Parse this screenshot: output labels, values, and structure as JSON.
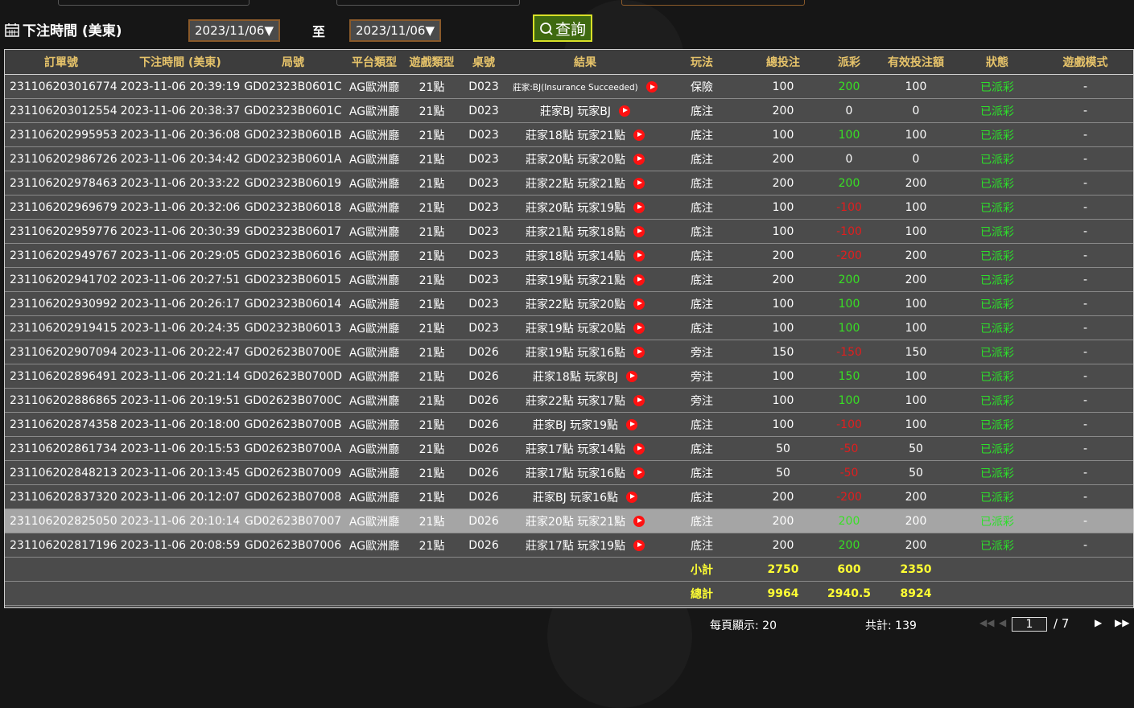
{
  "filter": {
    "label": "下注時間 (美東)",
    "start_date": "2023/11/06▼",
    "to": "至",
    "end_date": "2023/11/06▼",
    "search_label": "查詢"
  },
  "table": {
    "headers": [
      "訂單號",
      "下注時間 (美東)",
      "局號",
      "平台類型",
      "遊戲類型",
      "桌號",
      "結果",
      "玩法",
      "總投注",
      "派彩",
      "有效投注額",
      "狀態",
      "遊戲模式"
    ],
    "rows": [
      {
        "order": "231106203016774",
        "time": "2023-11-06 20:39:19",
        "round": "GD02323B0601C",
        "platform": "AG歐洲廳",
        "game": "21點",
        "table": "D023",
        "result": "莊家:BJ(Insurance Succeeded)",
        "play": "保險",
        "bet": "100",
        "payout": "200",
        "valid": "100",
        "status": "已派彩",
        "mode": "-"
      },
      {
        "order": "231106203012554",
        "time": "2023-11-06 20:38:37",
        "round": "GD02323B0601C",
        "platform": "AG歐洲廳",
        "game": "21點",
        "table": "D023",
        "result": "莊家BJ 玩家BJ",
        "play": "底注",
        "bet": "200",
        "payout": "0",
        "valid": "0",
        "status": "已派彩",
        "mode": "-"
      },
      {
        "order": "231106202995953",
        "time": "2023-11-06 20:36:08",
        "round": "GD02323B0601B",
        "platform": "AG歐洲廳",
        "game": "21點",
        "table": "D023",
        "result": "莊家18點 玩家21點",
        "play": "底注",
        "bet": "100",
        "payout": "100",
        "valid": "100",
        "status": "已派彩",
        "mode": "-"
      },
      {
        "order": "231106202986726",
        "time": "2023-11-06 20:34:42",
        "round": "GD02323B0601A",
        "platform": "AG歐洲廳",
        "game": "21點",
        "table": "D023",
        "result": "莊家20點 玩家20點",
        "play": "底注",
        "bet": "200",
        "payout": "0",
        "valid": "0",
        "status": "已派彩",
        "mode": "-"
      },
      {
        "order": "231106202978463",
        "time": "2023-11-06 20:33:22",
        "round": "GD02323B06019",
        "platform": "AG歐洲廳",
        "game": "21點",
        "table": "D023",
        "result": "莊家22點 玩家21點",
        "play": "底注",
        "bet": "200",
        "payout": "200",
        "valid": "200",
        "status": "已派彩",
        "mode": "-"
      },
      {
        "order": "231106202969679",
        "time": "2023-11-06 20:32:06",
        "round": "GD02323B06018",
        "platform": "AG歐洲廳",
        "game": "21點",
        "table": "D023",
        "result": "莊家20點 玩家19點",
        "play": "底注",
        "bet": "100",
        "payout": "-100",
        "valid": "100",
        "status": "已派彩",
        "mode": "-"
      },
      {
        "order": "231106202959776",
        "time": "2023-11-06 20:30:39",
        "round": "GD02323B06017",
        "platform": "AG歐洲廳",
        "game": "21點",
        "table": "D023",
        "result": "莊家21點 玩家18點",
        "play": "底注",
        "bet": "100",
        "payout": "-100",
        "valid": "100",
        "status": "已派彩",
        "mode": "-"
      },
      {
        "order": "231106202949767",
        "time": "2023-11-06 20:29:05",
        "round": "GD02323B06016",
        "platform": "AG歐洲廳",
        "game": "21點",
        "table": "D023",
        "result": "莊家18點 玩家14點",
        "play": "底注",
        "bet": "200",
        "payout": "-200",
        "valid": "200",
        "status": "已派彩",
        "mode": "-"
      },
      {
        "order": "231106202941702",
        "time": "2023-11-06 20:27:51",
        "round": "GD02323B06015",
        "platform": "AG歐洲廳",
        "game": "21點",
        "table": "D023",
        "result": "莊家19點 玩家21點",
        "play": "底注",
        "bet": "200",
        "payout": "200",
        "valid": "200",
        "status": "已派彩",
        "mode": "-"
      },
      {
        "order": "231106202930992",
        "time": "2023-11-06 20:26:17",
        "round": "GD02323B06014",
        "platform": "AG歐洲廳",
        "game": "21點",
        "table": "D023",
        "result": "莊家22點 玩家20點",
        "play": "底注",
        "bet": "100",
        "payout": "100",
        "valid": "100",
        "status": "已派彩",
        "mode": "-"
      },
      {
        "order": "231106202919415",
        "time": "2023-11-06 20:24:35",
        "round": "GD02323B06013",
        "platform": "AG歐洲廳",
        "game": "21點",
        "table": "D023",
        "result": "莊家19點 玩家20點",
        "play": "底注",
        "bet": "100",
        "payout": "100",
        "valid": "100",
        "status": "已派彩",
        "mode": "-"
      },
      {
        "order": "231106202907094",
        "time": "2023-11-06 20:22:47",
        "round": "GD02623B0700E",
        "platform": "AG歐洲廳",
        "game": "21點",
        "table": "D026",
        "result": "莊家19點 玩家16點",
        "play": "旁注",
        "bet": "150",
        "payout": "-150",
        "valid": "150",
        "status": "已派彩",
        "mode": "-"
      },
      {
        "order": "231106202896491",
        "time": "2023-11-06 20:21:14",
        "round": "GD02623B0700D",
        "platform": "AG歐洲廳",
        "game": "21點",
        "table": "D026",
        "result": "莊家18點 玩家BJ",
        "play": "旁注",
        "bet": "100",
        "payout": "150",
        "valid": "100",
        "status": "已派彩",
        "mode": "-"
      },
      {
        "order": "231106202886865",
        "time": "2023-11-06 20:19:51",
        "round": "GD02623B0700C",
        "platform": "AG歐洲廳",
        "game": "21點",
        "table": "D026",
        "result": "莊家22點 玩家17點",
        "play": "旁注",
        "bet": "100",
        "payout": "100",
        "valid": "100",
        "status": "已派彩",
        "mode": "-"
      },
      {
        "order": "231106202874358",
        "time": "2023-11-06 20:18:00",
        "round": "GD02623B0700B",
        "platform": "AG歐洲廳",
        "game": "21點",
        "table": "D026",
        "result": "莊家BJ 玩家19點",
        "play": "底注",
        "bet": "100",
        "payout": "-100",
        "valid": "100",
        "status": "已派彩",
        "mode": "-"
      },
      {
        "order": "231106202861734",
        "time": "2023-11-06 20:15:53",
        "round": "GD02623B0700A",
        "platform": "AG歐洲廳",
        "game": "21點",
        "table": "D026",
        "result": "莊家17點 玩家14點",
        "play": "底注",
        "bet": "50",
        "payout": "-50",
        "valid": "50",
        "status": "已派彩",
        "mode": "-"
      },
      {
        "order": "231106202848213",
        "time": "2023-11-06 20:13:45",
        "round": "GD02623B07009",
        "platform": "AG歐洲廳",
        "game": "21點",
        "table": "D026",
        "result": "莊家17點 玩家16點",
        "play": "底注",
        "bet": "50",
        "payout": "-50",
        "valid": "50",
        "status": "已派彩",
        "mode": "-"
      },
      {
        "order": "231106202837320",
        "time": "2023-11-06 20:12:07",
        "round": "GD02623B07008",
        "platform": "AG歐洲廳",
        "game": "21點",
        "table": "D026",
        "result": "莊家BJ 玩家16點",
        "play": "底注",
        "bet": "200",
        "payout": "-200",
        "valid": "200",
        "status": "已派彩",
        "mode": "-"
      },
      {
        "order": "231106202825050",
        "time": "2023-11-06 20:10:14",
        "round": "GD02623B07007",
        "platform": "AG歐洲廳",
        "game": "21點",
        "table": "D026",
        "result": "莊家20點 玩家21點",
        "play": "底注",
        "bet": "200",
        "payout": "200",
        "valid": "200",
        "status": "已派彩",
        "mode": "-"
      },
      {
        "order": "231106202817196",
        "time": "2023-11-06 20:08:59",
        "round": "GD02623B07006",
        "platform": "AG歐洲廳",
        "game": "21點",
        "table": "D026",
        "result": "莊家17點 玩家19點",
        "play": "底注",
        "bet": "200",
        "payout": "200",
        "valid": "200",
        "status": "已派彩",
        "mode": "-"
      }
    ],
    "subtotal": {
      "label": "小計",
      "bet": "2750",
      "payout": "600",
      "valid": "2350"
    },
    "total": {
      "label": "總計",
      "bet": "9964",
      "payout": "2940.5",
      "valid": "8924"
    }
  },
  "footer": {
    "per_page": "每頁顯示: 20",
    "total": "共計: 139",
    "page": "1",
    "page_sep": "/  7"
  },
  "colors": {
    "header_text": "#e6c36a",
    "positive": "#38e024",
    "negative": "#e01e1e",
    "status": "#2ce02a",
    "summary": "#ffff33",
    "search_border": "#d8e028",
    "date_border": "#8a5a2a"
  }
}
